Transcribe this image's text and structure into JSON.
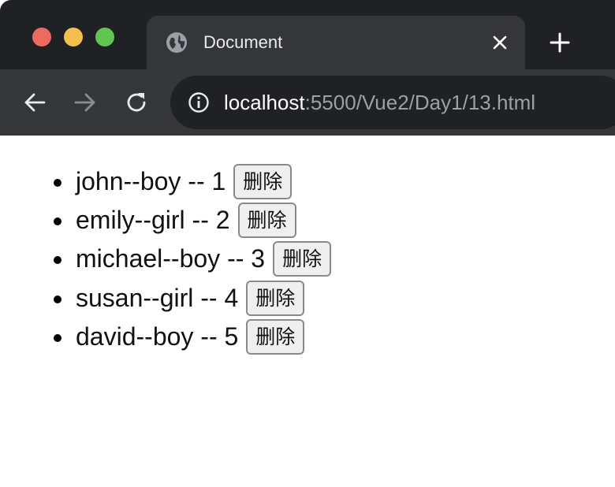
{
  "tab": {
    "title": "Document"
  },
  "address_bar": {
    "host": "localhost",
    "path": ":5500/Vue2/Day1/13.html"
  },
  "items": [
    {
      "text": "john--boy -- 1",
      "button": "删除"
    },
    {
      "text": "emily--girl -- 2",
      "button": "删除"
    },
    {
      "text": "michael--boy -- 3",
      "button": "删除"
    },
    {
      "text": "susan--girl -- 4",
      "button": "删除"
    },
    {
      "text": "david--boy -- 5",
      "button": "删除"
    }
  ]
}
